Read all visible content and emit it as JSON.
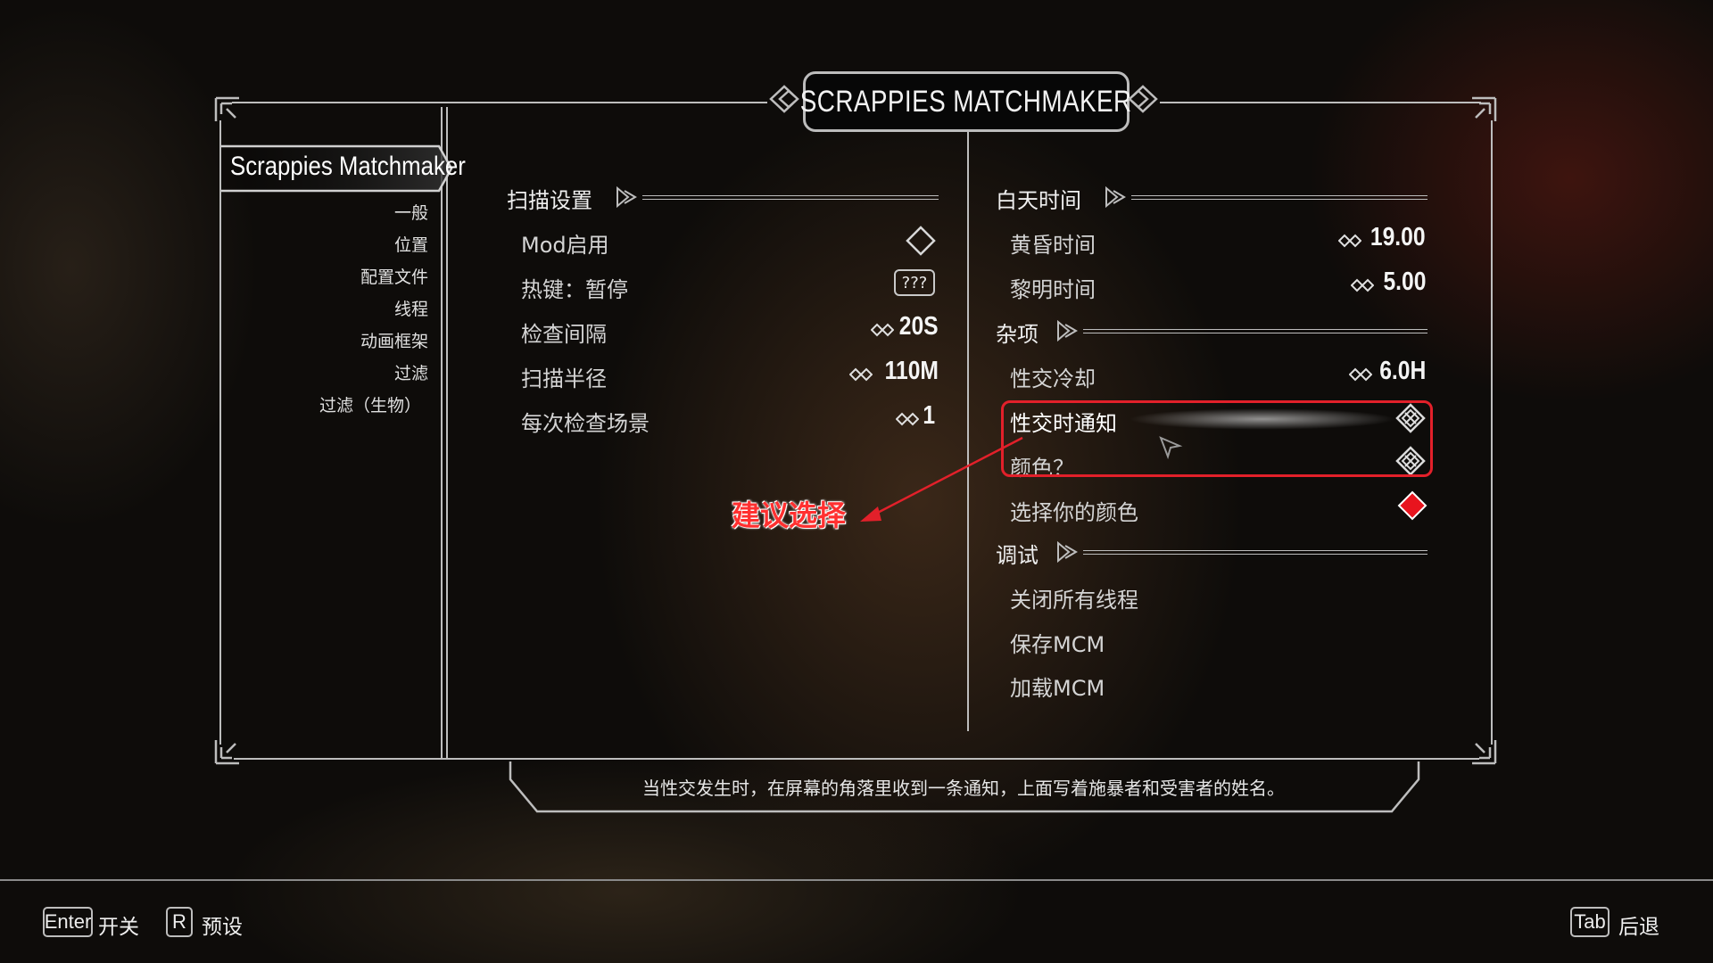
{
  "window": {
    "title": "SCRAPPIES MATCHMAKER"
  },
  "sidebar": {
    "mod_name": "Scrappies Matchmaker",
    "items": [
      {
        "label": "一般"
      },
      {
        "label": "位置"
      },
      {
        "label": "配置文件"
      },
      {
        "label": "线程"
      },
      {
        "label": "动画框架"
      },
      {
        "label": "过滤"
      },
      {
        "label": "过滤（生物）"
      }
    ]
  },
  "left_column": {
    "section_title": "扫描设置",
    "options": {
      "mod_enable": {
        "label": "Mod启用"
      },
      "hotkey_pause": {
        "label": "热键：暂停",
        "value": "???"
      },
      "check_interval": {
        "label": "检查间隔",
        "value": "20S"
      },
      "scan_radius": {
        "label": "扫描半径",
        "value": "110M"
      },
      "scenes_per_check": {
        "label": "每次检查场景",
        "value": "1"
      }
    }
  },
  "right_column": {
    "daytime": {
      "section_title": "白天时间",
      "dusk": {
        "label": "黄昏时间",
        "value": "19.00"
      },
      "dawn": {
        "label": "黎明时间",
        "value": "5.00"
      }
    },
    "misc": {
      "section_title": "杂项",
      "cooldown": {
        "label": "性交冷却",
        "value": "6.0H"
      },
      "notify": {
        "label": "性交时通知"
      },
      "color_q": {
        "label": "颜色？"
      },
      "pick_color": {
        "label": "选择你的颜色",
        "color": "#e8141e"
      }
    },
    "debug": {
      "section_title": "调试",
      "close_threads": {
        "label": "关闭所有线程"
      },
      "save_mcm": {
        "label": "保存MCM"
      },
      "load_mcm": {
        "label": "加载MCM"
      }
    }
  },
  "annotation": {
    "text": "建议选择",
    "color": "#ff3030"
  },
  "info_bar": {
    "text": "当性交发生时，在屏幕的角落里收到一条通知，上面写着施暴者和受害者的姓名。"
  },
  "bottom_bar": {
    "enter": {
      "key": "Enter",
      "label": "开关"
    },
    "r": {
      "key": "R",
      "label": "预设"
    },
    "tab": {
      "key": "Tab",
      "label": "后退"
    }
  }
}
